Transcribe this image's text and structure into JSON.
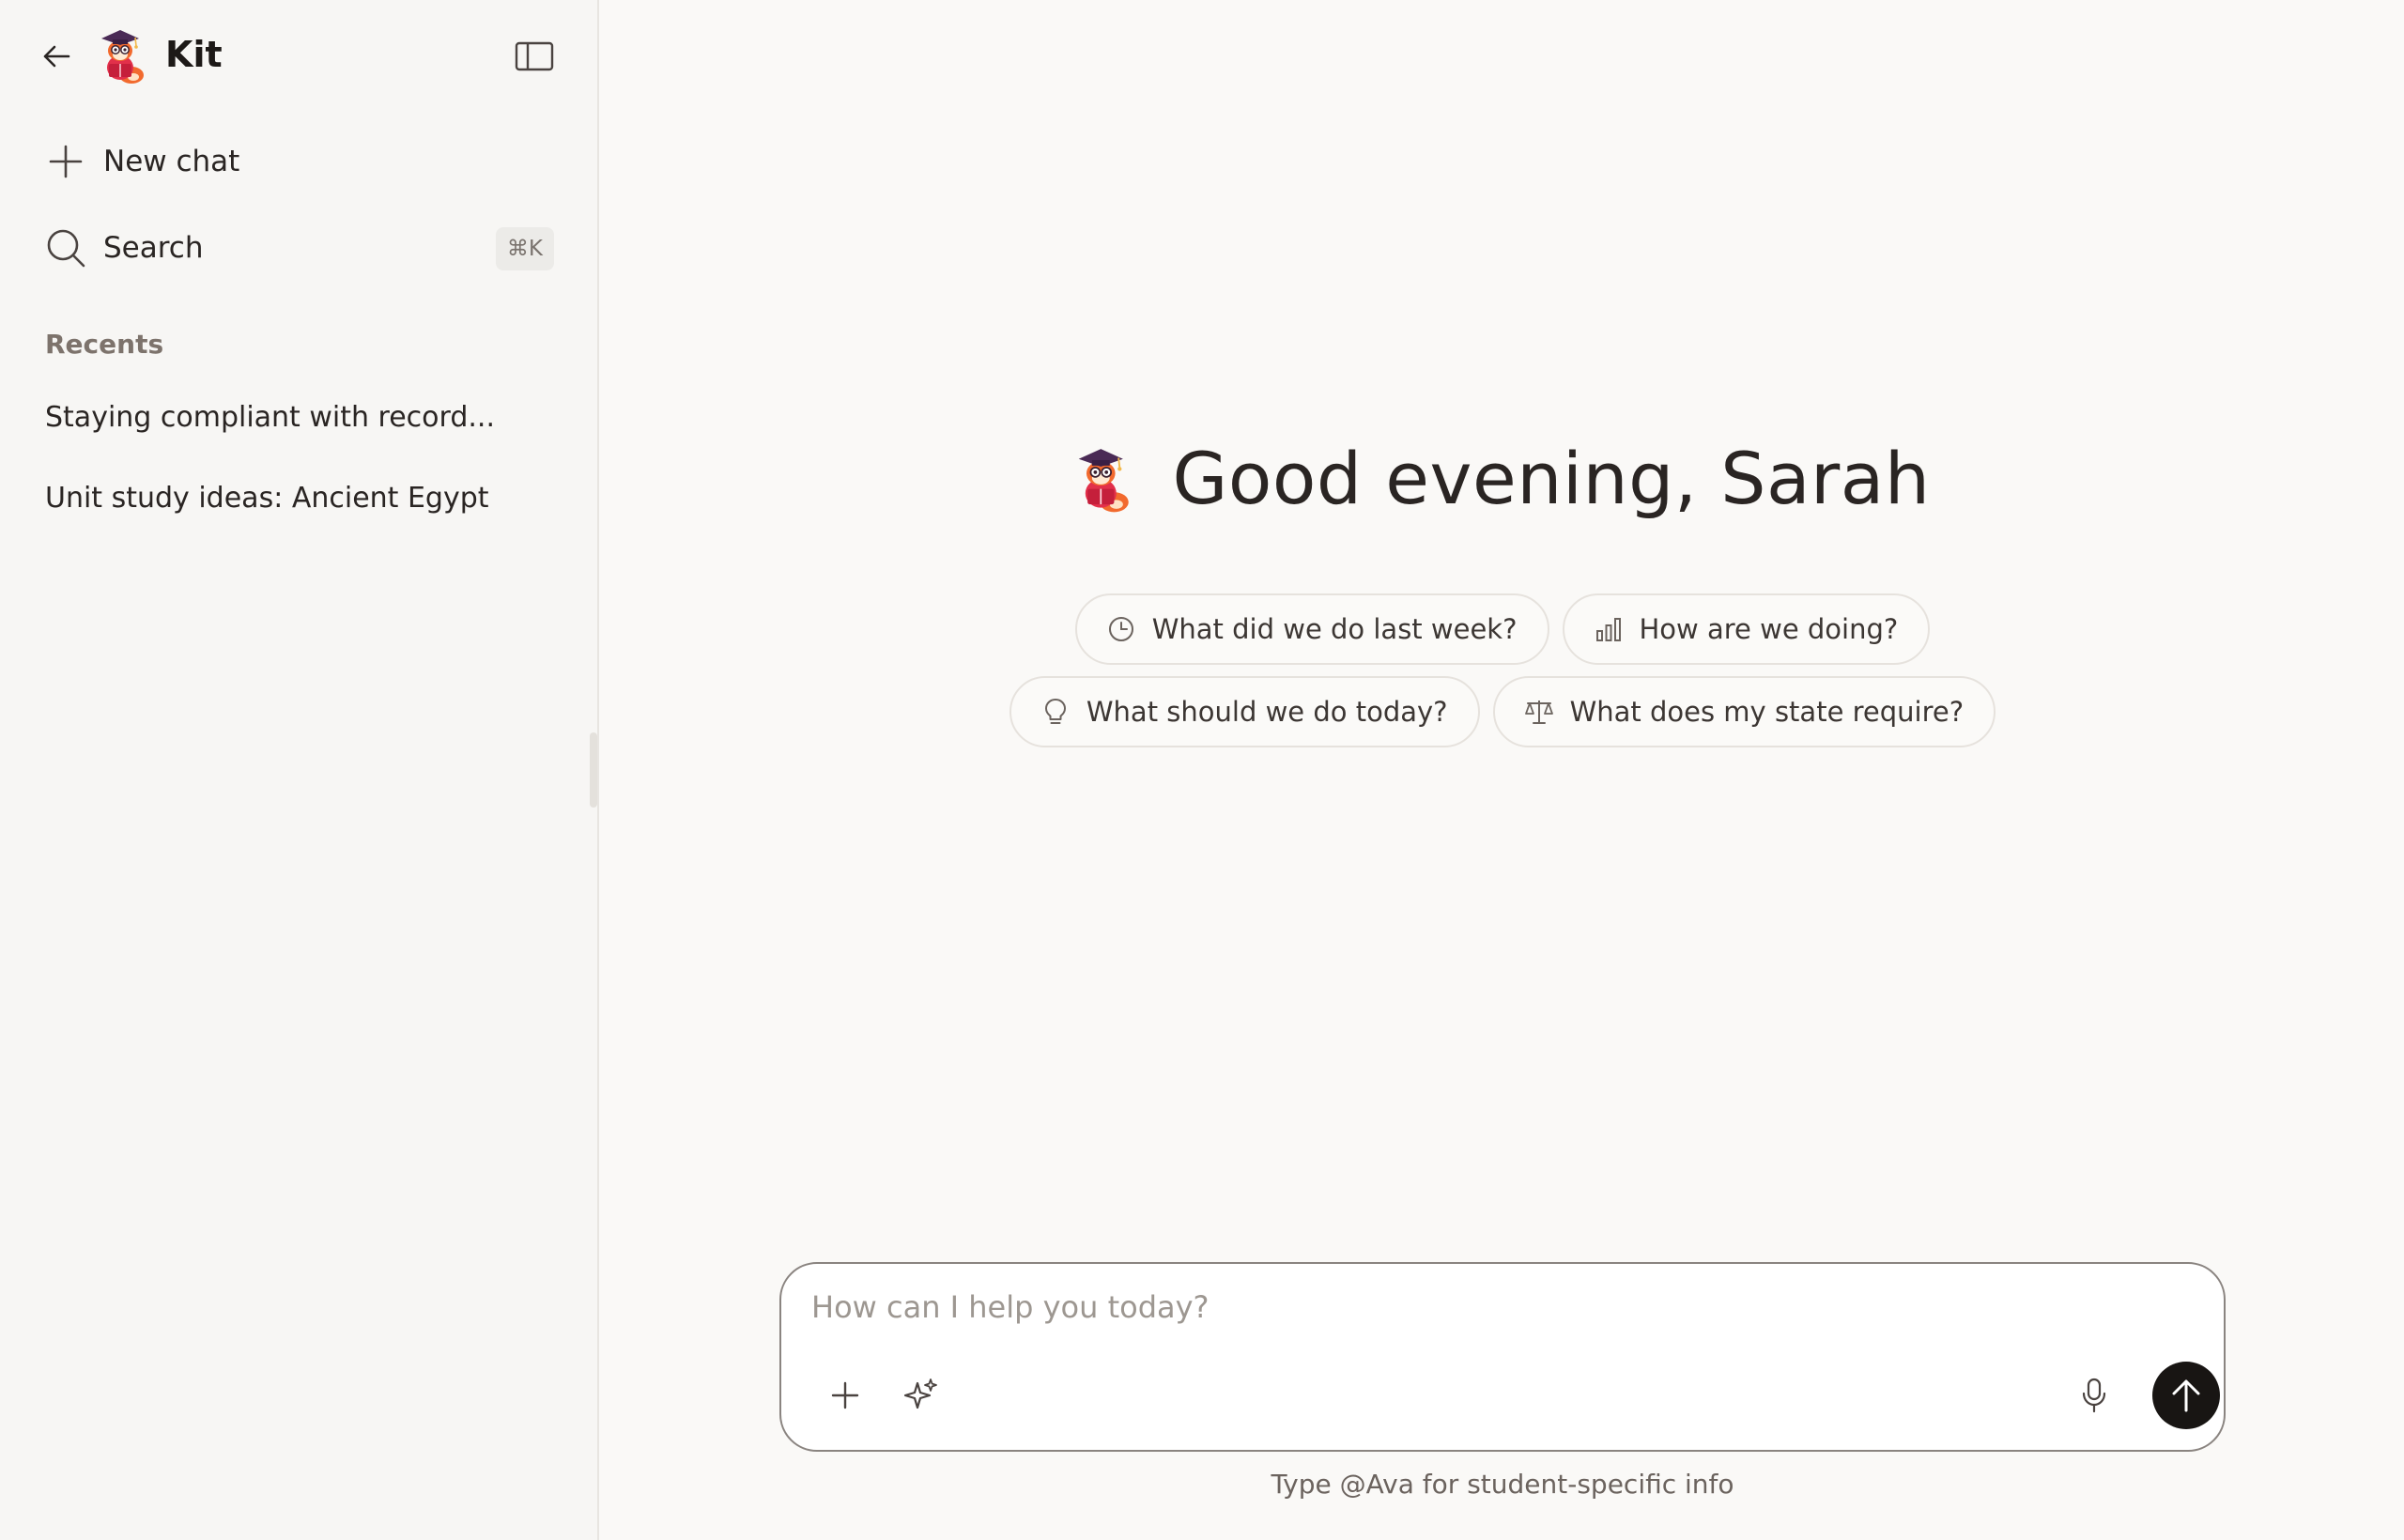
{
  "app": {
    "title": "Kit"
  },
  "sidebar": {
    "new_chat_label": "New chat",
    "search_label": "Search",
    "search_shortcut": "⌘K",
    "recents_title": "Recents",
    "recents": [
      "Staying compliant with record...",
      "Unit study ideas: Ancient Egypt"
    ]
  },
  "main": {
    "greeting": "Good evening, Sarah",
    "suggestions_row1": [
      {
        "label": "What did we do last week?",
        "icon": "clock-icon"
      },
      {
        "label": "How are we doing?",
        "icon": "bar-chart-icon"
      }
    ],
    "suggestions_row2": [
      {
        "label": "What should we do today?",
        "icon": "lightbulb-icon"
      },
      {
        "label": "What does my state require?",
        "icon": "scales-icon"
      }
    ],
    "composer": {
      "placeholder": "How can I help you today?"
    },
    "hint": "Type @Ava for student-specific info"
  },
  "colors": {
    "background": "#faf9f7",
    "sidebar_bg": "#f7f6f4",
    "send_button": "#181513",
    "mascot_purple": "#4a2a55",
    "mascot_red": "#e2304a",
    "mascot_orange": "#f26a2e"
  }
}
